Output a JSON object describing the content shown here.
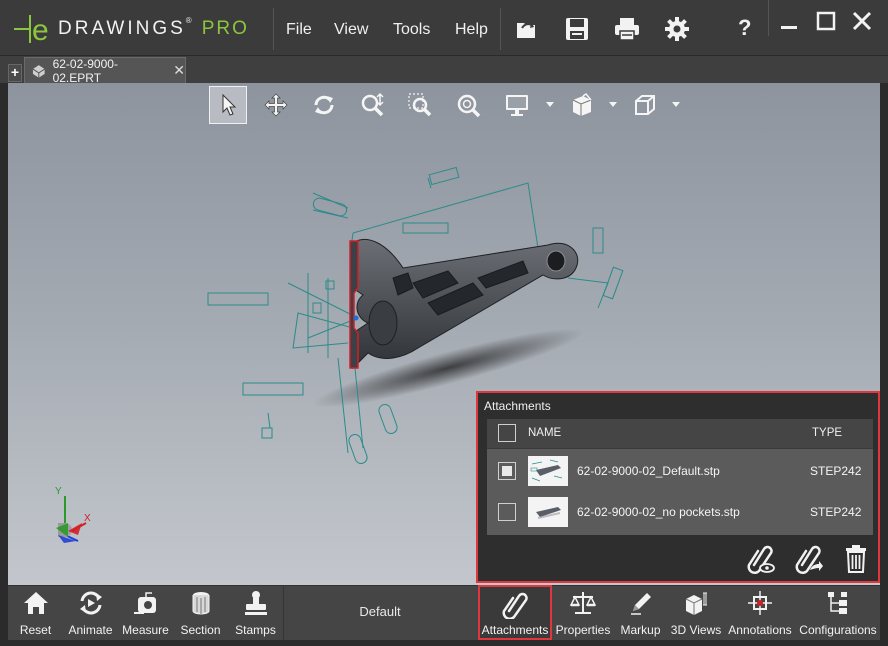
{
  "app": {
    "logo_letter": "e",
    "brand": "DRAWINGS",
    "brand_mark": "®",
    "edition": "PRO",
    "accent_color": "#8cc63f",
    "highlight_color": "#e0373f"
  },
  "menu": [
    {
      "label": "File"
    },
    {
      "label": "View"
    },
    {
      "label": "Tools"
    },
    {
      "label": "Help"
    }
  ],
  "title_icons": [
    "open-file-icon",
    "save-icon",
    "print-icon",
    "settings-gear-icon",
    "help-icon"
  ],
  "help_glyph": "?",
  "window_controls": [
    "minimize-icon",
    "maximize-icon",
    "close-icon"
  ],
  "tabs": {
    "new_tab_glyph": "+",
    "active": {
      "filename": "62-02-9000-02.EPRT",
      "close_glyph": "✕"
    }
  },
  "view_toolbar": [
    "select-arrow-icon",
    "pan-icon",
    "rotate-icon",
    "zoom-icon",
    "zoom-to-area-icon",
    "zoom-to-fit-icon",
    "display-mode-icon",
    "view-orientation-icon",
    "standard-views-cube-icon"
  ],
  "triad": {
    "x": "X",
    "y": "Y"
  },
  "attachments": {
    "title": "Attachments",
    "columns": {
      "name": "NAME",
      "type": "TYPE"
    },
    "header_checked": false,
    "rows": [
      {
        "name": "62-02-9000-02_Default.stp",
        "type": "STEP242",
        "checked": true
      },
      {
        "name": "62-02-9000-02_no pockets.stp",
        "type": "STEP242",
        "checked": false
      }
    ],
    "actions": [
      "view-attachment-icon",
      "open-attachment-icon",
      "delete-icon"
    ]
  },
  "bottom_toolbar": {
    "left": [
      {
        "label": "Reset",
        "icon": "home-icon"
      },
      {
        "label": "Animate",
        "icon": "animate-icon"
      },
      {
        "label": "Measure",
        "icon": "measure-icon"
      },
      {
        "label": "Section",
        "icon": "section-icon"
      },
      {
        "label": "Stamps",
        "icon": "stamp-icon"
      }
    ],
    "configuration": "Default",
    "right": [
      {
        "label": "Attachments",
        "icon": "paperclip-icon"
      },
      {
        "label": "Properties",
        "icon": "scales-icon"
      },
      {
        "label": "Markup",
        "icon": "pencil-icon"
      },
      {
        "label": "3D Views",
        "icon": "3d-views-icon"
      },
      {
        "label": "Annotations",
        "icon": "annotations-icon"
      },
      {
        "label": "Configurations",
        "icon": "configurations-icon"
      }
    ]
  }
}
